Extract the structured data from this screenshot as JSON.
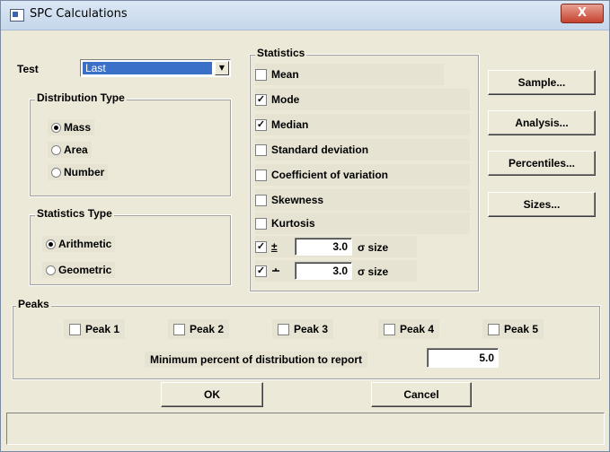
{
  "window": {
    "title": "SPC Calculations",
    "close_glyph": "X"
  },
  "test": {
    "label": "Test",
    "value": "Last",
    "arrow_icon": "chevron-down-icon"
  },
  "distribution_type": {
    "title": "Distribution Type",
    "options": [
      {
        "label": "Mass",
        "selected": true
      },
      {
        "label": "Area",
        "selected": false
      },
      {
        "label": "Number",
        "selected": false
      }
    ]
  },
  "statistics_type": {
    "title": "Statistics Type",
    "options": [
      {
        "label": "Arithmetic",
        "selected": true
      },
      {
        "label": "Geometric",
        "selected": false
      }
    ]
  },
  "statistics": {
    "title": "Statistics",
    "items": [
      {
        "label": "Mean",
        "checked": false
      },
      {
        "label": "Mode",
        "checked": true
      },
      {
        "label": "Median",
        "checked": true
      },
      {
        "label": "Standard deviation",
        "checked": false
      },
      {
        "label": "Coefficient of variation",
        "checked": false
      },
      {
        "label": "Skewness",
        "checked": false
      },
      {
        "label": "Kurtosis",
        "checked": false
      }
    ],
    "sigma_plus": {
      "sign": "±",
      "value": "3.0",
      "unit": "σ size",
      "checked": true
    },
    "sigma_minus": {
      "sign": "∸",
      "value": "3.0",
      "unit": "σ size",
      "checked": true
    }
  },
  "side_buttons": [
    "Sample...",
    "Analysis...",
    "Percentiles...",
    "Sizes..."
  ],
  "peaks": {
    "title": "Peaks",
    "items": [
      "Peak 1",
      "Peak 2",
      "Peak 3",
      "Peak 4",
      "Peak 5"
    ],
    "min_percent_label": "Minimum percent of distribution to report",
    "min_percent_value": "5.0"
  },
  "buttons": {
    "ok": "OK",
    "cancel": "Cancel"
  },
  "status_text": ""
}
